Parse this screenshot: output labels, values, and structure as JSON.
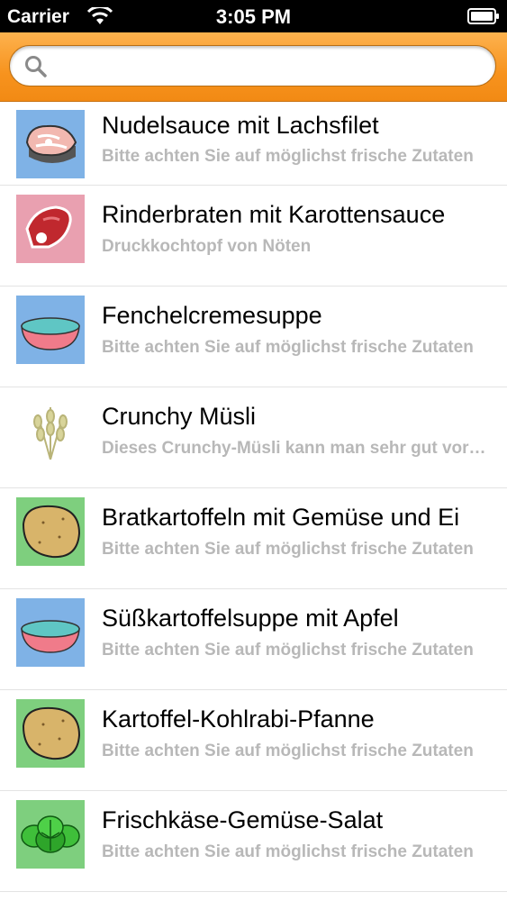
{
  "status_bar": {
    "carrier": "Carrier",
    "time": "3:05 PM"
  },
  "search": {
    "placeholder": "",
    "value": ""
  },
  "colors": {
    "accent": "#f7931e",
    "thumb_blue": "#7fb2e6",
    "thumb_pink": "#e9a0b0",
    "thumb_green": "#7ecf7e"
  },
  "recipes": [
    {
      "title": "Nudelsauce mit Lachsfilet",
      "subtitle": "Bitte achten Sie auf möglichst frische Zutaten",
      "icon": "salmon-steak-icon",
      "bg": "#7fb2e6"
    },
    {
      "title": "Rinderbraten mit Karottensauce",
      "subtitle": "Druckkochtopf von Nöten",
      "icon": "beef-steak-icon",
      "bg": "#e9a0b0"
    },
    {
      "title": "Fenchelcremesuppe",
      "subtitle": "Bitte achten Sie auf möglichst frische Zutaten",
      "icon": "soup-bowl-icon",
      "bg": "#7fb2e6"
    },
    {
      "title": "Crunchy Müsli",
      "subtitle": "Dieses Crunchy-Müsli kann man sehr gut vorbereiten",
      "icon": "wheat-icon",
      "bg": "#ffffff"
    },
    {
      "title": "Bratkartoffeln mit Gemüse und Ei",
      "subtitle": "Bitte achten Sie auf möglichst frische Zutaten",
      "icon": "potato-icon",
      "bg": "#7ecf7e"
    },
    {
      "title": "Süßkartoffelsuppe mit Apfel",
      "subtitle": "Bitte achten Sie auf möglichst frische Zutaten",
      "icon": "soup-bowl-icon",
      "bg": "#7fb2e6"
    },
    {
      "title": "Kartoffel-Kohlrabi-Pfanne",
      "subtitle": "Bitte achten Sie auf möglichst frische Zutaten",
      "icon": "potato-icon",
      "bg": "#7ecf7e"
    },
    {
      "title": "Frischkäse-Gemüse-Salat",
      "subtitle": "Bitte achten Sie auf möglichst frische Zutaten",
      "icon": "lettuce-icon",
      "bg": "#7ecf7e"
    }
  ]
}
